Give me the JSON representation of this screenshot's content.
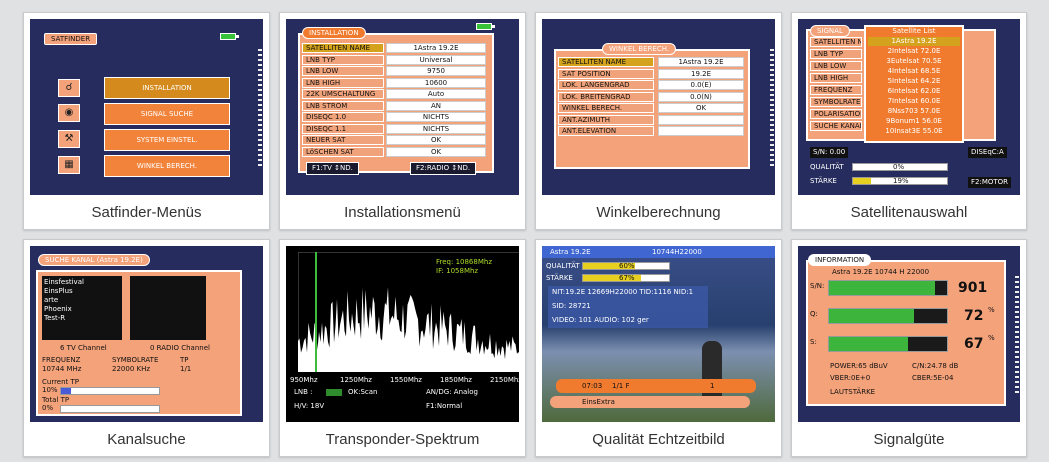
{
  "tiles": [
    {
      "caption": "Satfinder-Menüs"
    },
    {
      "caption": "Installationsmenü"
    },
    {
      "caption": "Winkelberechnung"
    },
    {
      "caption": "Satellitenauswahl"
    },
    {
      "caption": "Kanalsuche"
    },
    {
      "caption": "Transponder-Spektrum"
    },
    {
      "caption": "Qualität Echtzeitbild"
    },
    {
      "caption": "Signalgüte"
    }
  ],
  "satfinder": {
    "title": "SATFINDER",
    "items": [
      "INSTALLATION",
      "SIGNAL SUCHE",
      "SYSTEM EINSTEL.",
      "WINKEL BERECH."
    ]
  },
  "installation": {
    "title": "INSTALLATION",
    "rows": [
      {
        "label": "SATELLITEN NAME",
        "value": "1Astra 19.2E"
      },
      {
        "label": "LNB TYP",
        "value": "Universal"
      },
      {
        "label": "LNB LOW",
        "value": "9750"
      },
      {
        "label": "LNB HIGH",
        "value": "10600"
      },
      {
        "label": "22K UMSCHALTUNG",
        "value": "Auto"
      },
      {
        "label": "LNB STROM",
        "value": "AN"
      },
      {
        "label": "DISEQC 1.0",
        "value": "NICHTS"
      },
      {
        "label": "DISEQC 1.1",
        "value": "NICHTS"
      },
      {
        "label": "NEUER SAT",
        "value": "OK"
      },
      {
        "label": "LöSCHEN SAT",
        "value": "OK"
      }
    ],
    "f1": "F1:TV ↕ND.",
    "f2": "F2:RADIO ↕ND."
  },
  "winkel": {
    "title": "WINKEL BERECH.",
    "rows": [
      {
        "label": "SATELLITEN NAME",
        "value": "1Astra 19.2E"
      },
      {
        "label": "SAT POSITION",
        "value": "19.2E"
      },
      {
        "label": "LOK. LÄNGENGRAD",
        "value": "0.0(E)"
      },
      {
        "label": "LOK. BREITENGRAD",
        "value": "0.0(N)"
      },
      {
        "label": "WINKEL BERECH.",
        "value": "OK"
      },
      {
        "label": "ANT.AZIMUTH",
        "value": ""
      },
      {
        "label": "ANT.ELEVATION",
        "value": ""
      }
    ]
  },
  "satlist": {
    "title": "SIGNAL",
    "list_title": "Satellite List",
    "items": [
      "1Astra 19.2E",
      "2Intelsat 72.0E",
      "3Eutelsat 70.5E",
      "4Intelsat 68.5E",
      "5Intelsat 64.2E",
      "6Intelsat 62.0E",
      "7Intelsat 60.0E",
      "8Nss703 57.0E",
      "9Bonum1 56.0E",
      "10Insat3E 55.0E"
    ],
    "labels": [
      "SATELLITEN NAME",
      "LNB TYP",
      "LNB LOW",
      "LNB HIGH",
      "FREQUENZ",
      "SYMBOLRATE",
      "POLARISATION",
      "SUCHE KANAL"
    ],
    "sn": "S/N: 0.00",
    "dbs": "DISEqC:A",
    "qualitat": "QUALITÄT",
    "qual_val": "0%",
    "starke": "STÄRKE",
    "starke_val": "19%",
    "motor": "F2:MOTOR",
    "starke_level": 0.19
  },
  "kanal": {
    "title": "SUCHE KANAL",
    "sat": "(Astra 19.2E)",
    "channels": [
      "Einsfestival",
      "EinsPlus",
      "arte",
      "Phoenix",
      "Test-R"
    ],
    "tv": "6 TV Channel",
    "radio": "0 RADIO Channel",
    "freq_label": "FREQUENZ",
    "freq_val": "10744 MHz",
    "sym_label": "SYMBOLRATE",
    "sym_val": "22000 KHz",
    "tp_label": "TP",
    "tp_val": "1/1",
    "current": "Current TP",
    "current_pct": "10%",
    "total": "Total TP",
    "total_pct": "0%",
    "current_level": 0.1,
    "total_level": 0.0
  },
  "spectrum": {
    "freq": "Freq: 10868Mhz",
    "if": "IF: 1058Mhz",
    "axis": [
      "950Mhz",
      "1250Mhz",
      "1550Mhz",
      "1850Mhz",
      "2150Mhz"
    ],
    "lnb": "LNB :",
    "ok": "OK:Scan",
    "andg": "AN/DG: Analog",
    "hv": "H/V: 18V",
    "f1": "F1:Normal"
  },
  "realtime": {
    "sat": "Astra 19.2E",
    "tp": "10744H22000",
    "qual": "QUALITÄT",
    "qual_val": "60%",
    "starke": "STÄRKE",
    "starke_val": "67%",
    "qual_level": 0.6,
    "starke_level": 0.67,
    "nit": "NIT:19.2E  12669H22000  TID:1116  NID:1",
    "sid": "SID:  28721",
    "video": "VIDEO:  101  AUDIO:  102  ger",
    "time": "07:03",
    "ch": "1/1 F",
    "num": "1",
    "chan": "EinsExtra"
  },
  "quality": {
    "title": "INFORMATION",
    "tp": "Astra 19.2E  10744  H  22000",
    "sn": "S/N:",
    "sn_val": "901",
    "q": "Q:",
    "q_val": "72",
    "q_unit": "%",
    "s": "S:",
    "s_val": "67",
    "s_unit": "%",
    "q_level": 0.72,
    "s_level": 0.67,
    "sn_level": 0.9,
    "power": "POWER:65 dBuV",
    "cn": "C/N:24.78 dB",
    "vber": "VBER:0E+0",
    "cber": "CBER:5E-04",
    "laut": "LAUTSTÄRKE"
  }
}
